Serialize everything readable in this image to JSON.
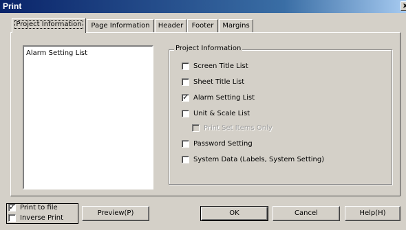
{
  "window": {
    "title": "Print",
    "close_glyph": "x"
  },
  "tabs": [
    {
      "label": "Project Information",
      "active": true
    },
    {
      "label": "Page Information",
      "active": false
    },
    {
      "label": "Header",
      "active": false
    },
    {
      "label": "Footer",
      "active": false
    },
    {
      "label": "Margins",
      "active": false
    }
  ],
  "list": {
    "items": [
      "Alarm Setting List"
    ]
  },
  "project_info": {
    "group_label": "Project Information",
    "options": [
      {
        "label": "Screen Title List",
        "checked": false,
        "disabled": false
      },
      {
        "label": "Sheet Title List",
        "checked": false,
        "disabled": false
      },
      {
        "label": "Alarm Setting List",
        "checked": true,
        "disabled": false
      },
      {
        "label": "Unit & Scale List",
        "checked": false,
        "disabled": false
      },
      {
        "label": "Print Set Items Only",
        "checked": false,
        "disabled": true
      },
      {
        "label": "Password Setting",
        "checked": false,
        "disabled": false
      },
      {
        "label": "System Data (Labels, System Setting)",
        "checked": false,
        "disabled": false
      }
    ]
  },
  "bottom": {
    "print_to_file": {
      "label": "Print to file",
      "checked": true
    },
    "inverse_print": {
      "label": "Inverse Print",
      "checked": false
    },
    "preview_label": "Preview(P)",
    "ok_label": "OK",
    "cancel_label": "Cancel",
    "help_label": "Help(H)"
  },
  "icons": {
    "checkmark": "check-icon",
    "close": "close-icon"
  }
}
